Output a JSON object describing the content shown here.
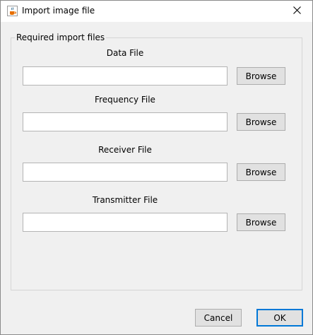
{
  "window": {
    "title": "Import image file"
  },
  "group": {
    "title": "Required import files"
  },
  "fields": [
    {
      "label": "Data File",
      "value": "",
      "browse_label": "Browse"
    },
    {
      "label": "Frequency File",
      "value": "",
      "browse_label": "Browse"
    },
    {
      "label": "Receiver File",
      "value": "",
      "browse_label": "Browse"
    },
    {
      "label": "Transmitter File",
      "value": "",
      "browse_label": "Browse"
    }
  ],
  "footer": {
    "cancel_label": "Cancel",
    "ok_label": "OK"
  },
  "icons": {
    "app": "java-cup-icon",
    "close": "close-icon"
  },
  "colors": {
    "default_button_border": "#0078d7",
    "titlebar": "#ffffff",
    "background": "#f0f0f0"
  }
}
